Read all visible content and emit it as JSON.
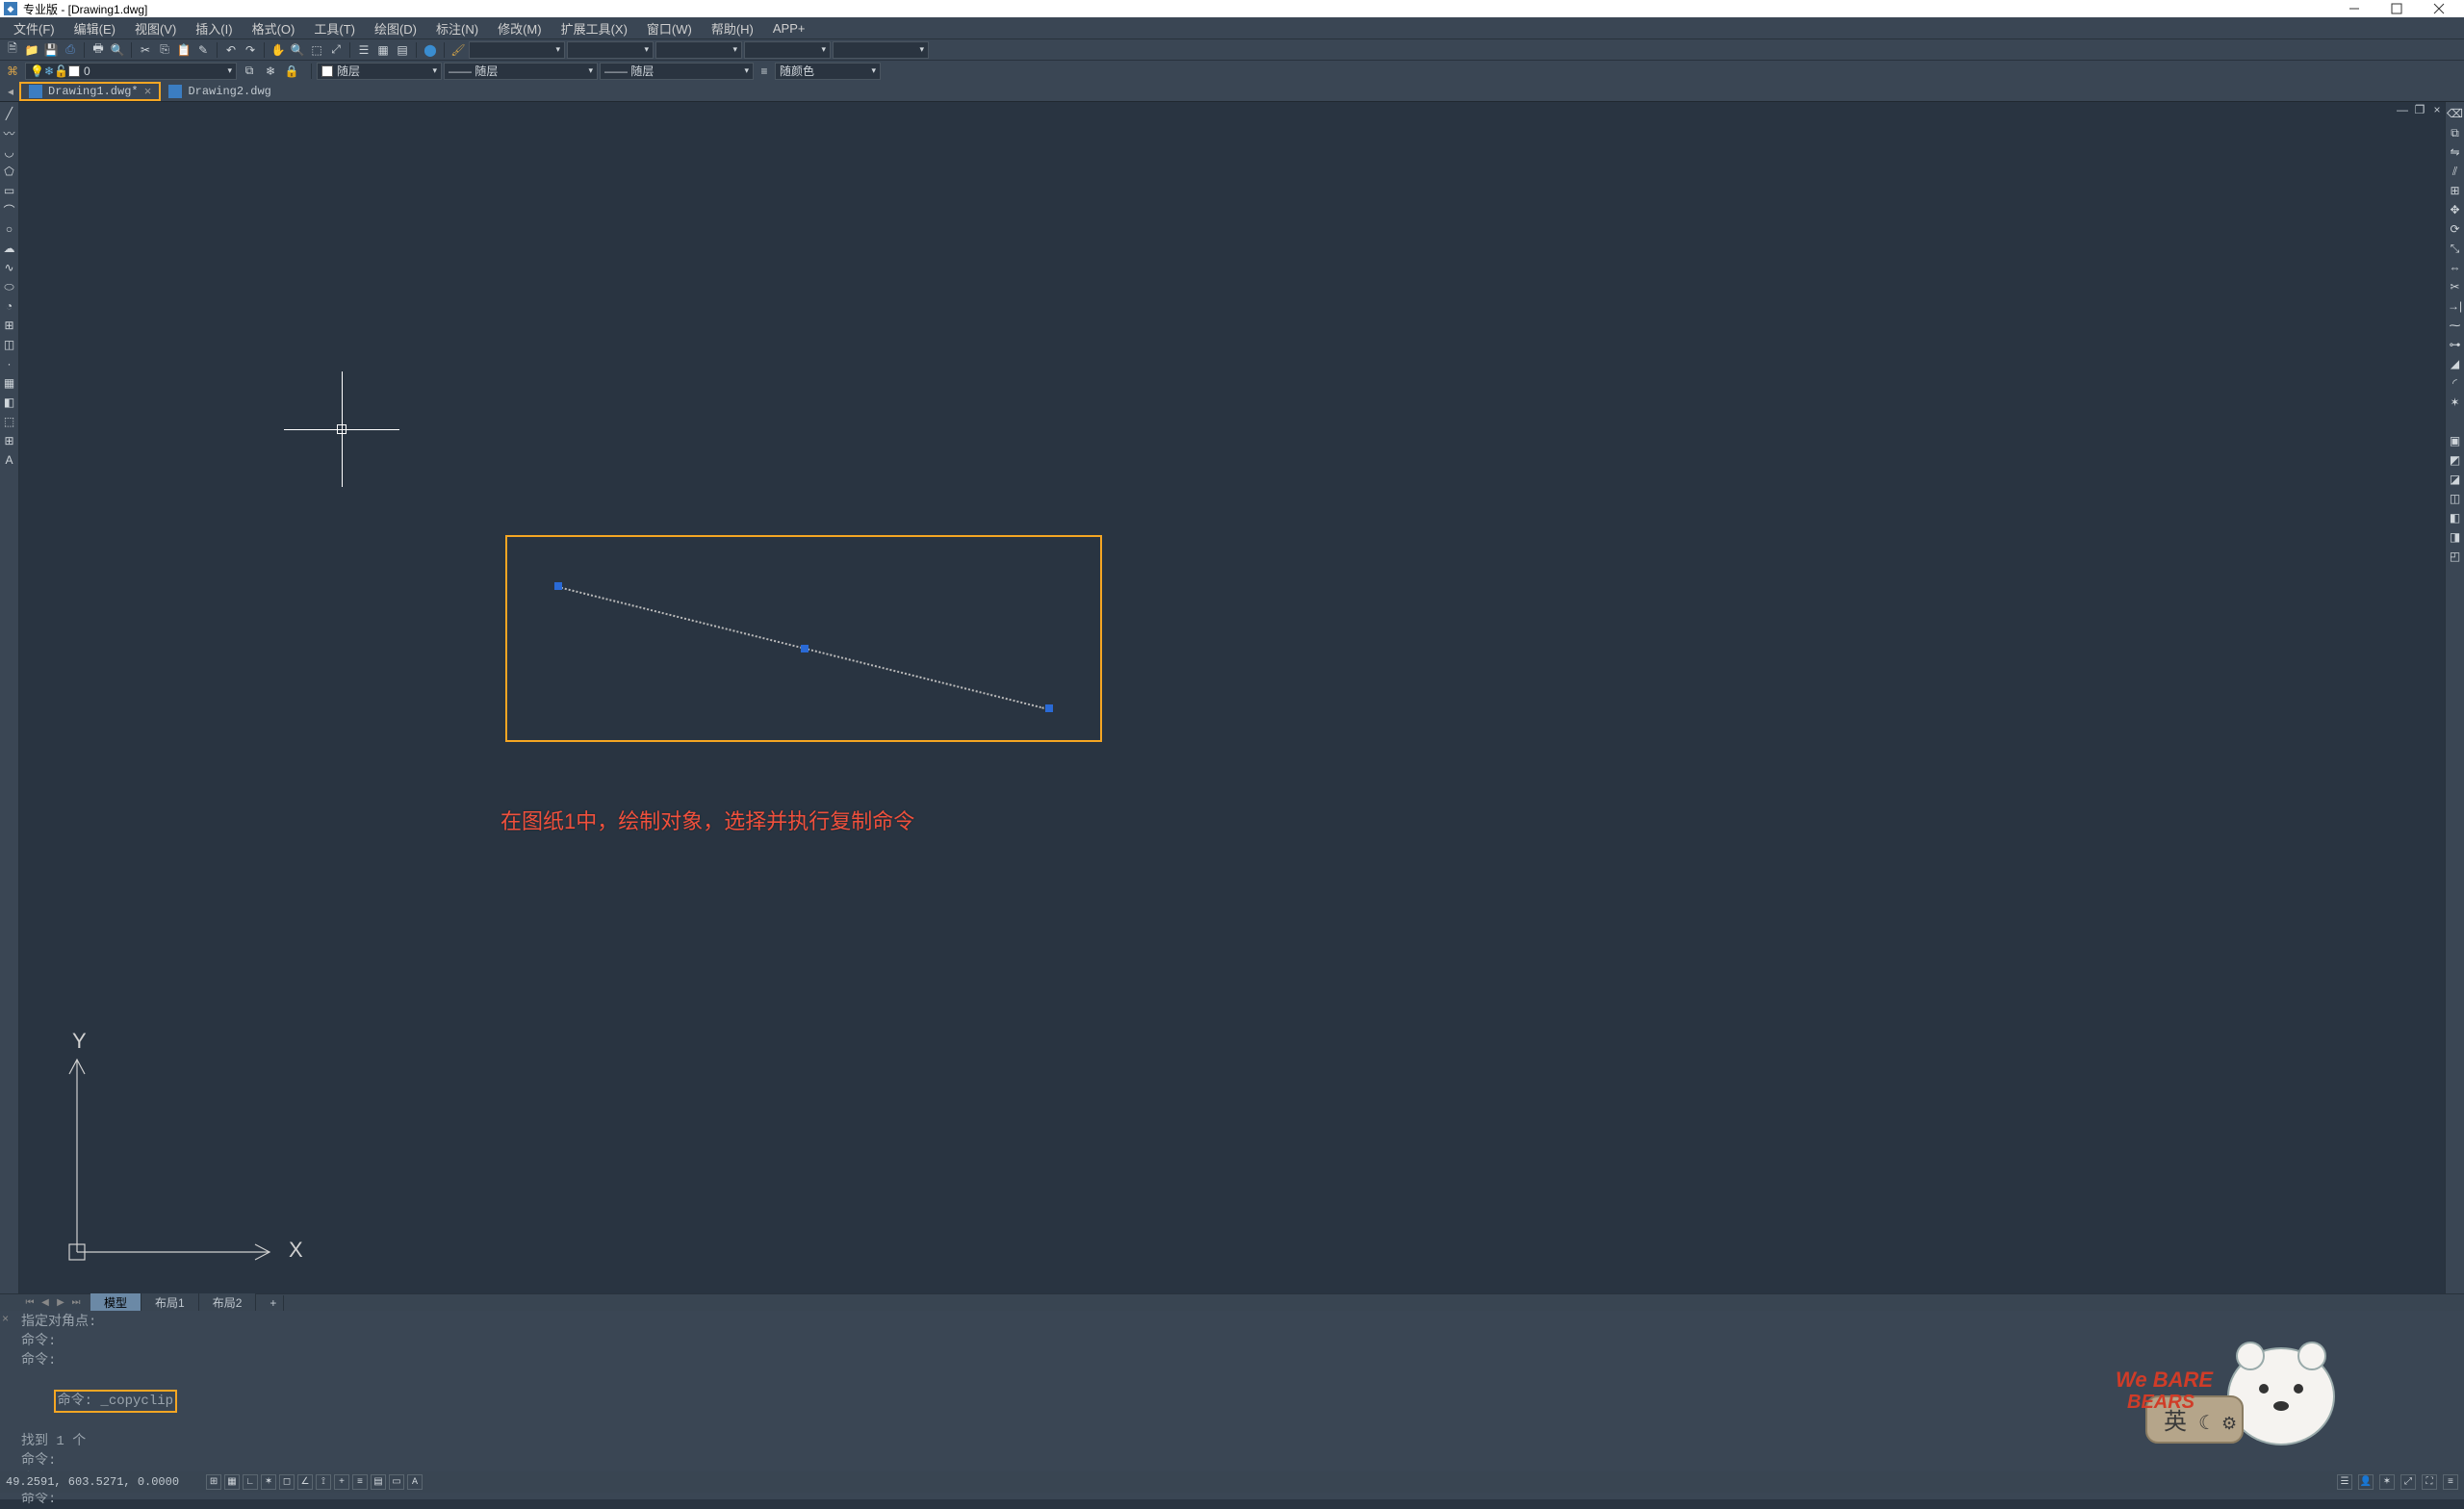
{
  "window": {
    "title": "专业版 - [Drawing1.dwg]"
  },
  "menus": [
    "文件(F)",
    "编辑(E)",
    "视图(V)",
    "插入(I)",
    "格式(O)",
    "工具(T)",
    "绘图(D)",
    "标注(N)",
    "修改(M)",
    "扩展工具(X)",
    "窗口(W)",
    "帮助(H)",
    "APP+"
  ],
  "layer": {
    "current": "0",
    "dropdown1": "随层",
    "dropdown2": "—— 随层",
    "dropdown3": "—— 随层",
    "dropdown4": "随颜色"
  },
  "tabs": [
    {
      "label": "Drawing1.dwg*",
      "active": true,
      "closeable": true
    },
    {
      "label": "Drawing2.dwg",
      "active": false,
      "closeable": false
    }
  ],
  "layout_tabs": {
    "model": "模型",
    "layouts": [
      "布局1",
      "布局2"
    ],
    "add": "+"
  },
  "annotation": "在图纸1中，绘制对象，选择并执行复制命令",
  "ucs": {
    "x": "X",
    "y": "Y"
  },
  "command_history": [
    "指定对角点:",
    "命令:",
    "命令:",
    "命令: _copyclip",
    "找到 1 个",
    "命令:",
    "命令:"
  ],
  "command_prompt": "命令: ",
  "status": {
    "coords": "49.2591, 603.5271, 0.0000"
  },
  "ime": "英"
}
